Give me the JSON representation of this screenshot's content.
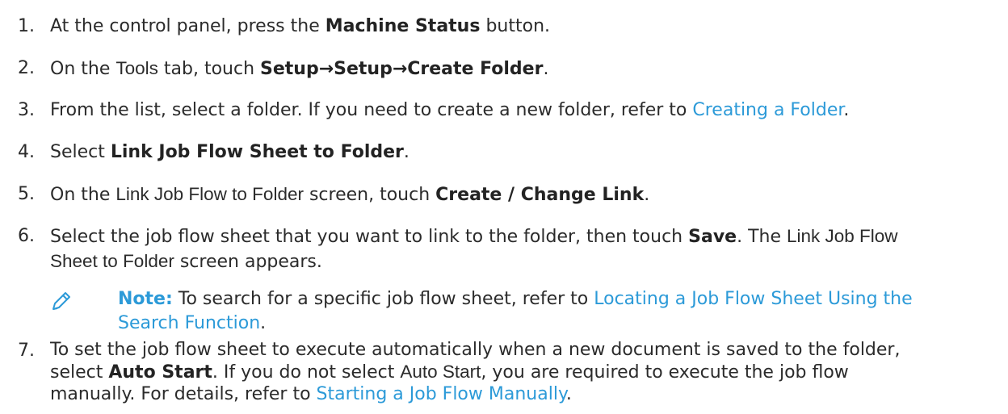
{
  "steps": [
    {
      "number": "1.",
      "t1": "At the control panel, press the ",
      "b1": "Machine Status",
      "t2": " button."
    },
    {
      "number": "2.",
      "t1": "On the ",
      "a1": "Tools",
      "t2": " tab, touch ",
      "b1": "Setup→Setup→Create Folder",
      "t3": "."
    },
    {
      "number": "3.",
      "t1": "From the list, select a folder. If you need to create a new folder, refer to ",
      "link": "Creating a Folder",
      "t2": "."
    },
    {
      "number": "4.",
      "t1": "Select ",
      "b1": "Link Job Flow Sheet to Folder",
      "t2": "."
    },
    {
      "number": "5.",
      "t1": "On the ",
      "a1": "Link Job Flow to Folder",
      "t2": " screen, touch ",
      "b1": "Create / Change Link",
      "t3": "."
    },
    {
      "number": "6.",
      "t1": "Select the job flow sheet that you want to link to the folder, then touch ",
      "b1": "Save",
      "t2": ". The ",
      "a1": "Link Job Flow",
      "a2": "Sheet to Folder",
      "t3": " screen appears."
    },
    {
      "number": "7.",
      "t1": "To set the job flow sheet to execute automatically when a new document is saved to the folder,",
      "t2": "select ",
      "b1": "Auto Start",
      "t3": ". If you do not select ",
      "a1": "Auto Start",
      "t4": ", you are required to execute the job flow",
      "t5": "manually. For details, refer to ",
      "link": "Starting a Job Flow Manually",
      "t6": "."
    }
  ],
  "note": {
    "label": "Note:",
    "t1": " To search for a specific job flow sheet, refer to ",
    "link_line1": "Locating a Job Flow Sheet Using the",
    "link_line2": "Search Function",
    "t2": ".",
    "icon": "pencil-icon"
  },
  "colors": {
    "text": "#2b2b2b",
    "link": "#2c9ad8"
  }
}
